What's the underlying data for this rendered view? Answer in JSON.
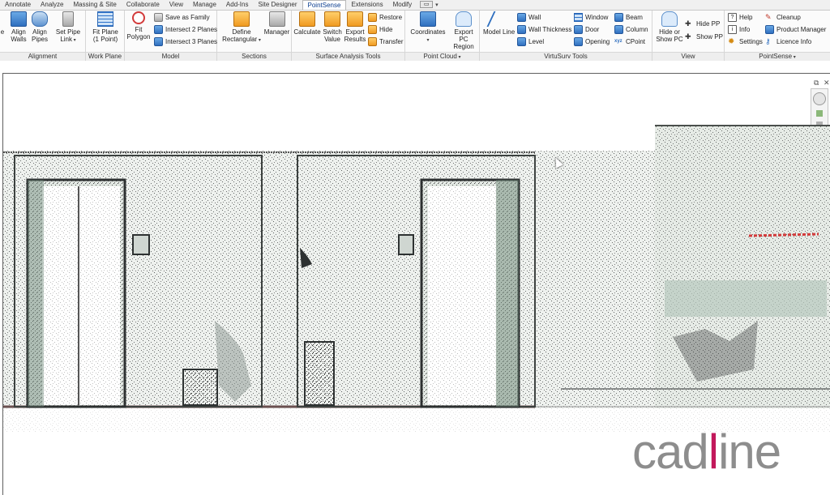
{
  "tabs": [
    {
      "label": "Annotate",
      "active": false
    },
    {
      "label": "Analyze",
      "active": false
    },
    {
      "label": "Massing & Site",
      "active": false
    },
    {
      "label": "Collaborate",
      "active": false
    },
    {
      "label": "View",
      "active": false
    },
    {
      "label": "Manage",
      "active": false
    },
    {
      "label": "Add-Ins",
      "active": false
    },
    {
      "label": "Site Designer",
      "active": false
    },
    {
      "label": "PointSense",
      "active": true
    },
    {
      "label": "Extensions",
      "active": false
    },
    {
      "label": "Modify",
      "active": false
    }
  ],
  "ribbon": {
    "alignment": {
      "title": "Alignment",
      "clip_label": "e",
      "align_walls": "Align Walls",
      "align_pipes": "Align Pipes",
      "set_pipe_link": "Set Pipe Link"
    },
    "work_plane": {
      "title": "Work Plane",
      "fit_plane": "Fit Plane (1 Point)"
    },
    "model": {
      "title": "Model",
      "fit_polygon": "Fit Polygon",
      "save_as_family": "Save as Family",
      "intersect_2": "Intersect 2 Planes",
      "intersect_3": "Intersect 3 Planes"
    },
    "sections": {
      "title": "Sections",
      "define_rectangular": "Define Rectangular",
      "manager": "Manager"
    },
    "surface_analysis": {
      "title": "Surface Analysis Tools",
      "calculate": "Calculate",
      "switch_value": "Switch Value",
      "export_results": "Export Results",
      "restore": "Restore",
      "hide": "Hide",
      "transfer": "Transfer"
    },
    "point_cloud": {
      "title": "Point Cloud",
      "coordinates": "Coordinates",
      "export_pc_region": "Export PC Region"
    },
    "virtusurv": {
      "title": "VirtuSurv Tools",
      "model_line": "Model Line",
      "wall": "Wall",
      "wall_thickness": "Wall Thickness",
      "level": "Level",
      "window": "Window",
      "door": "Door",
      "opening": "Opening",
      "beam": "Beam",
      "column": "Column",
      "cpoint": "CPoint"
    },
    "view": {
      "title": "View",
      "hide_or_show_pc": "Hide or Show PC",
      "hide_pp": "Hide PP",
      "show_pp": "Show PP"
    },
    "pointsense": {
      "title": "PointSense",
      "help": "Help",
      "info": "Info",
      "settings": "Settings",
      "cleanup": "Cleanup",
      "product_manager": "Product Manager",
      "licence_info": "Licence Info"
    }
  },
  "watermark": {
    "prefix": "cad",
    "accent": "l",
    "suffix": "ine"
  },
  "colors": {
    "accent": "#c2185b",
    "active_tab": "#0a3d8f",
    "pointcloud_dark": "#2d3131",
    "pointcloud_green": "#6f8a7a"
  }
}
